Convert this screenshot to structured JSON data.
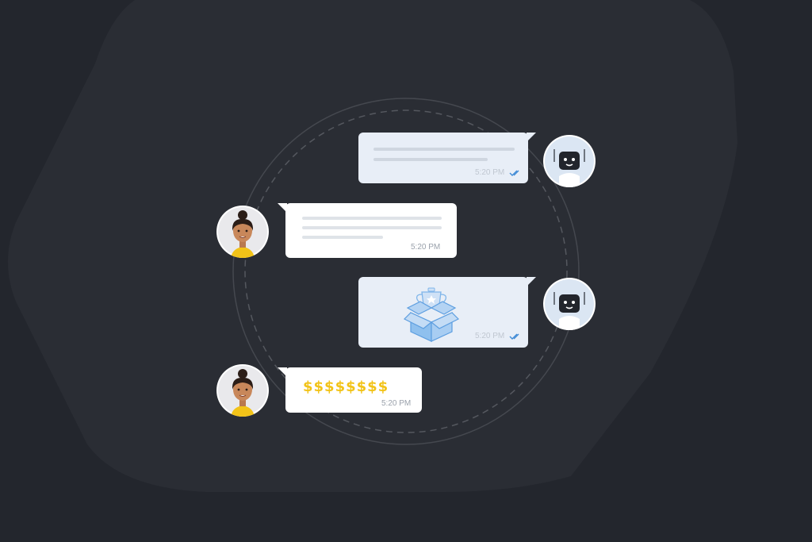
{
  "colors": {
    "background": "#23262d",
    "hexagon": "#2a2d34",
    "bot_bubble": "#e8eef7",
    "user_bubble": "#ffffff",
    "check_blue": "#3f8ad6",
    "dollar_yellow": "#f2c318",
    "box_blue": "#7fb5ea"
  },
  "messages": [
    {
      "sender": "bot",
      "time": "5:20 PM",
      "read": true,
      "icon": "double-check-icon"
    },
    {
      "sender": "user",
      "time": "5:20 PM"
    },
    {
      "sender": "bot",
      "time": "5:20 PM",
      "read": true,
      "icon": "trophy-box-icon"
    },
    {
      "sender": "user",
      "time": "5:20 PM",
      "text": "$$$$$$$$"
    }
  ],
  "icons": {
    "bot_avatar": "robot-icon",
    "user_avatar": "woman-avatar-icon",
    "attachment": "trophy-in-open-box-icon",
    "read_receipt": "double-check-icon"
  }
}
